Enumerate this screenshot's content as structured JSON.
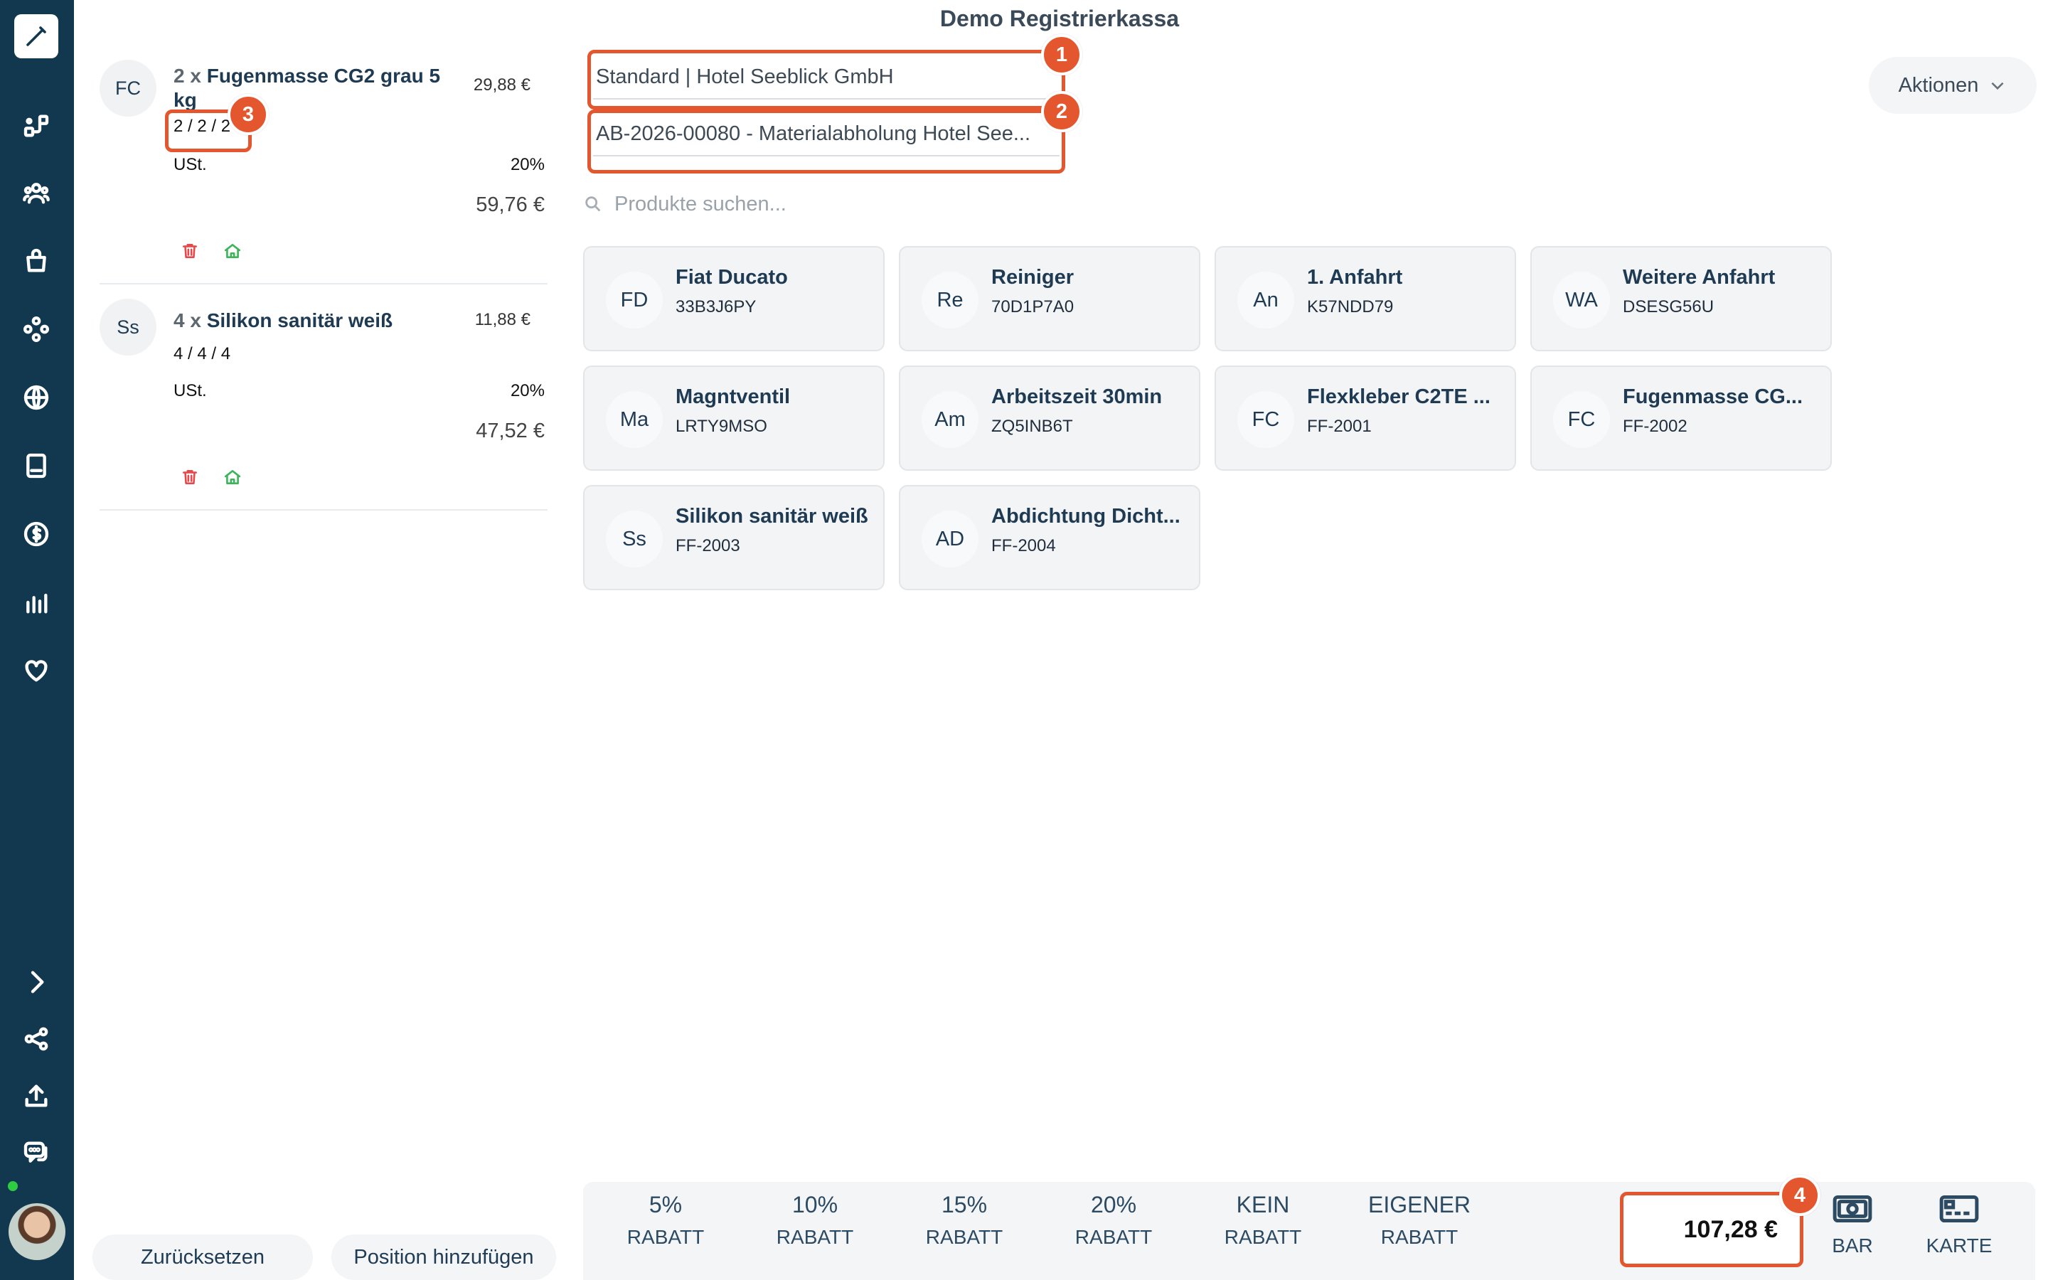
{
  "app": {
    "title": "Demo Registrierkassa"
  },
  "sidebar": {
    "icons": [
      "pen-icon",
      "workflow-icon",
      "users-icon",
      "shopping-bag-icon",
      "modules-icon",
      "globe-icon",
      "document-icon",
      "dollar-icon",
      "bar-chart-icon",
      "heart-icon",
      "chevron-right-icon",
      "share-icon",
      "upload-icon",
      "chat-icon"
    ]
  },
  "cart": {
    "items": [
      {
        "avatar": "FC",
        "qty": "2 x",
        "name": "Fugenmasse CG2 grau 5 kg",
        "unit_price": "29,88 €",
        "split": "2 / 2 / 2",
        "ust_label": "USt.",
        "ust_value": "20%",
        "total": "59,76 €"
      },
      {
        "avatar": "Ss",
        "qty": "4 x",
        "name": "Silikon sanitär weiß",
        "unit_price": "11,88 €",
        "split": "4 / 4 / 4",
        "ust_label": "USt.",
        "ust_value": "20%",
        "total": "47,52 €"
      }
    ],
    "reset_label": "Zurücksetzen",
    "add_position_label": "Position hinzufügen"
  },
  "header": {
    "customer_field": "Standard | Hotel Seeblick GmbH",
    "order_field": "AB-2026-00080 - Materialabholung Hotel See...",
    "search_placeholder": "Produkte suchen...",
    "actions_label": "Aktionen"
  },
  "badges": [
    "1",
    "2",
    "3",
    "4"
  ],
  "products": [
    {
      "avatar": "FD",
      "name": "Fiat Ducato",
      "sku": "33B3J6PY"
    },
    {
      "avatar": "Re",
      "name": "Reiniger",
      "sku": "70D1P7A0"
    },
    {
      "avatar": "An",
      "name": "1. Anfahrt",
      "sku": "K57NDD79"
    },
    {
      "avatar": "WA",
      "name": "Weitere Anfahrt",
      "sku": "DSESG56U"
    },
    {
      "avatar": "Ma",
      "name": "Magntventil",
      "sku": "LRTY9MSO"
    },
    {
      "avatar": "Am",
      "name": "Arbeitszeit 30min",
      "sku": "ZQ5INB6T"
    },
    {
      "avatar": "FC",
      "name": "Flexkleber C2TE ...",
      "sku": "FF-2001"
    },
    {
      "avatar": "FC",
      "name": "Fugenmasse CG...",
      "sku": "FF-2002"
    },
    {
      "avatar": "Ss",
      "name": "Silikon sanitär weiß",
      "sku": "FF-2003"
    },
    {
      "avatar": "AD",
      "name": "Abdichtung Dicht...",
      "sku": "FF-2004"
    }
  ],
  "discounts": [
    {
      "top": "5%",
      "bottom": "RABATT"
    },
    {
      "top": "10%",
      "bottom": "RABATT"
    },
    {
      "top": "15%",
      "bottom": "RABATT"
    },
    {
      "top": "20%",
      "bottom": "RABATT"
    },
    {
      "top": "KEIN",
      "bottom": "RABATT"
    },
    {
      "top": "EIGENER",
      "bottom": "RABATT"
    }
  ],
  "total": "107,28 €",
  "payment": {
    "cash_label": "BAR",
    "card_label": "KARTE"
  },
  "colors": {
    "sidebar": "#12384f",
    "highlight": "#e4572e",
    "delete": "#e4494b",
    "home": "#3bb45a"
  }
}
